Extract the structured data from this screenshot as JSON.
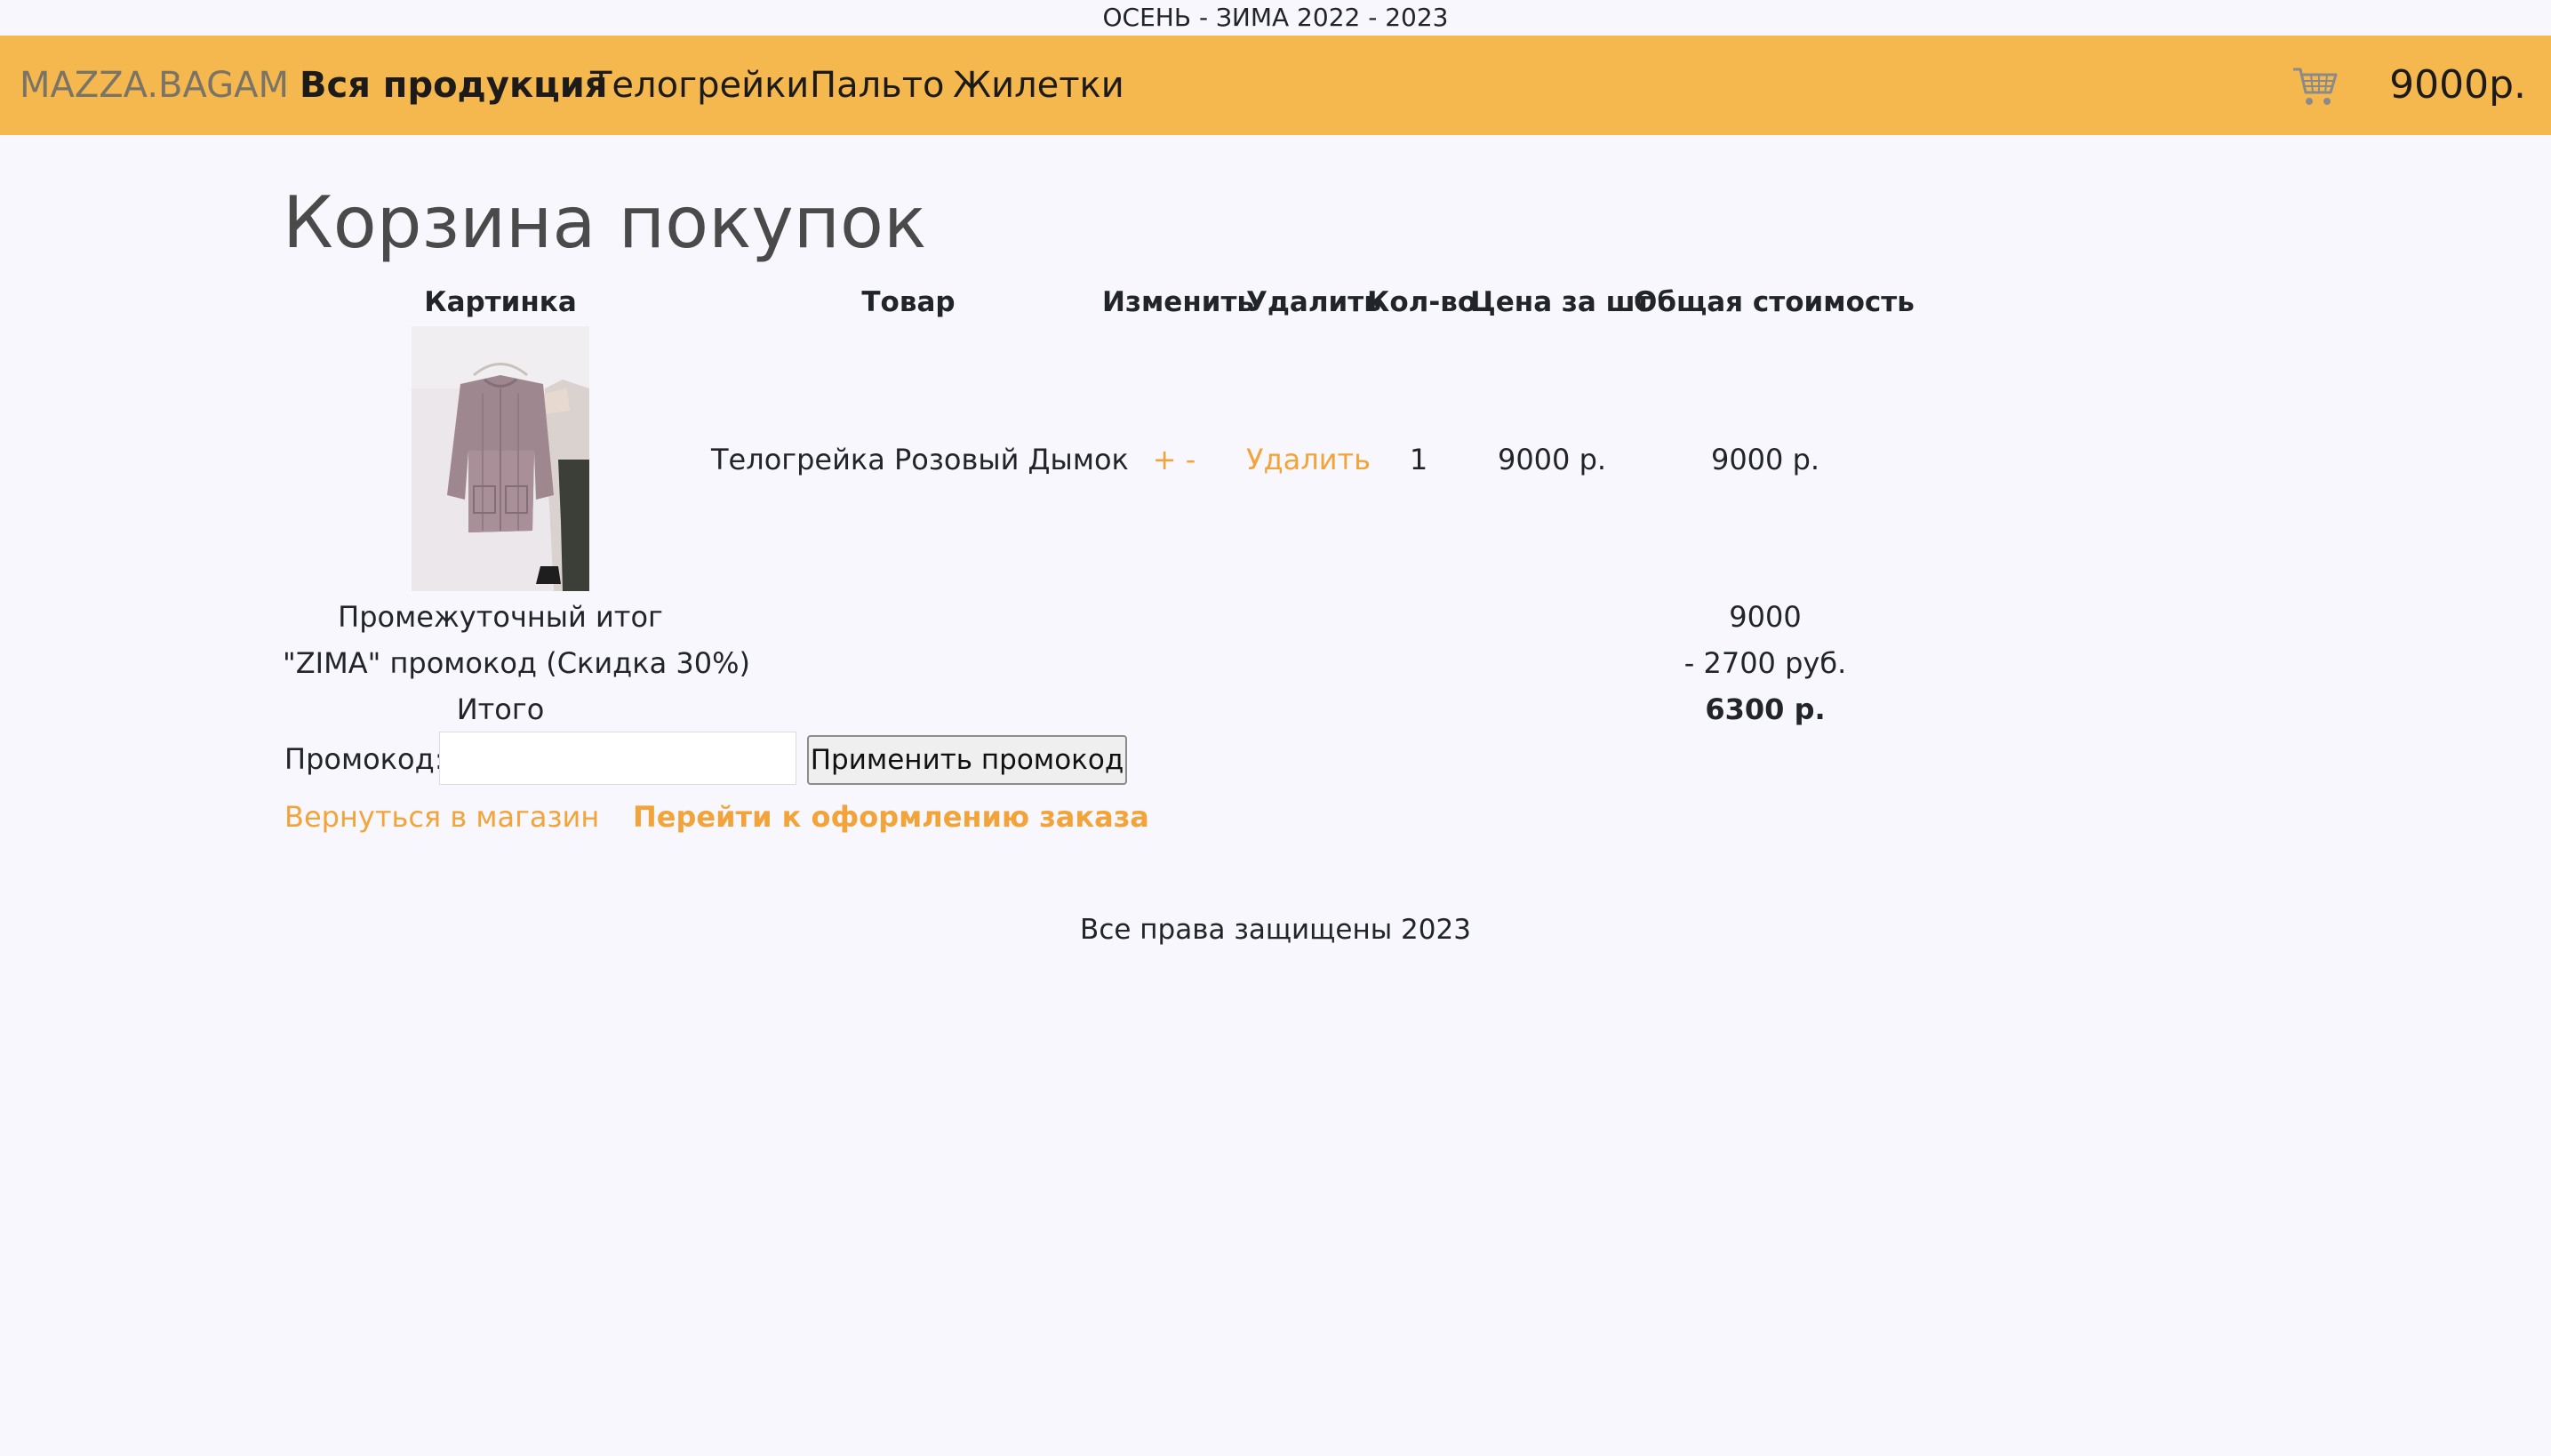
{
  "top_banner": "ОСЕНЬ - ЗИМА 2022 - 2023",
  "navbar": {
    "brand": "MAZZA.BAGAM",
    "links": [
      {
        "label": "Вся продукция",
        "active": true
      },
      {
        "label": "Телогрейки",
        "active": false
      },
      {
        "label": "Пальто",
        "active": false
      },
      {
        "label": "Жилетки",
        "active": false
      }
    ],
    "cart_icon": "shopping-cart-icon",
    "cart_total": "9000р.",
    "background_color": "#f5b84f"
  },
  "page_title": "Корзина покупок",
  "table": {
    "headers": {
      "image": "Картинка",
      "product": "Товар",
      "change": "Изменить",
      "delete": "Удалить",
      "quantity": "Кол-во",
      "unit_price": "Цена за шт",
      "total": "Общая стоимость"
    },
    "rows": [
      {
        "product": "Телогрейка Розовый Дымок",
        "change": "+ -",
        "delete": "Удалить",
        "quantity": "1",
        "unit_price": "9000 р.",
        "total": "9000 р."
      }
    ]
  },
  "summary": {
    "subtotal_label": "Промежуточный итог",
    "subtotal_value": "9000",
    "promo_label": "\"ZIMA\" промокод (Скидка 30%)",
    "promo_value": "- 2700 руб.",
    "total_label": "Итого",
    "total_value": "6300 р."
  },
  "promo_form": {
    "label": "Промокод:",
    "input_value": "",
    "input_placeholder": "",
    "button": "Применить промокод"
  },
  "actions": {
    "back": "Вернуться в магазин",
    "checkout": "Перейти к оформлению заказа"
  },
  "footer": "Все права защищены 2023",
  "colors": {
    "accent": "#f2a43a",
    "page_background": "#f8f7fd"
  }
}
